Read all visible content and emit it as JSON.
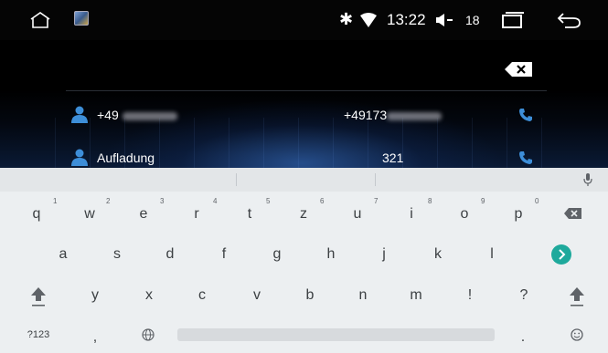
{
  "status_bar": {
    "bluetooth_glyph": "✱",
    "time": "13:22",
    "volume_level": "18",
    "icons": [
      "home-icon",
      "app-icon",
      "bluetooth-icon",
      "wifi-icon",
      "volume-icon",
      "recent-apps-icon",
      "back-icon"
    ]
  },
  "dialer": {
    "contacts": [
      {
        "name_prefix": "+49",
        "number": "+49173",
        "name_redacted": true
      },
      {
        "name_prefix": "Aufladung",
        "number": "321",
        "name_redacted": false
      }
    ]
  },
  "keyboard": {
    "row1": [
      {
        "key": "q",
        "hint": "1"
      },
      {
        "key": "w",
        "hint": "2"
      },
      {
        "key": "e",
        "hint": "3"
      },
      {
        "key": "r",
        "hint": "4"
      },
      {
        "key": "t",
        "hint": "5"
      },
      {
        "key": "z",
        "hint": "6"
      },
      {
        "key": "u",
        "hint": "7"
      },
      {
        "key": "i",
        "hint": "8"
      },
      {
        "key": "o",
        "hint": "9"
      },
      {
        "key": "p",
        "hint": "0"
      }
    ],
    "row2": [
      "a",
      "s",
      "d",
      "f",
      "g",
      "h",
      "j",
      "k",
      "l"
    ],
    "row3": [
      "y",
      "x",
      "c",
      "v",
      "b",
      "n",
      "m",
      "!",
      "?"
    ],
    "symbols_label": "?123",
    "comma": ",",
    "period": ".",
    "accent_color": "#1ea99c"
  }
}
